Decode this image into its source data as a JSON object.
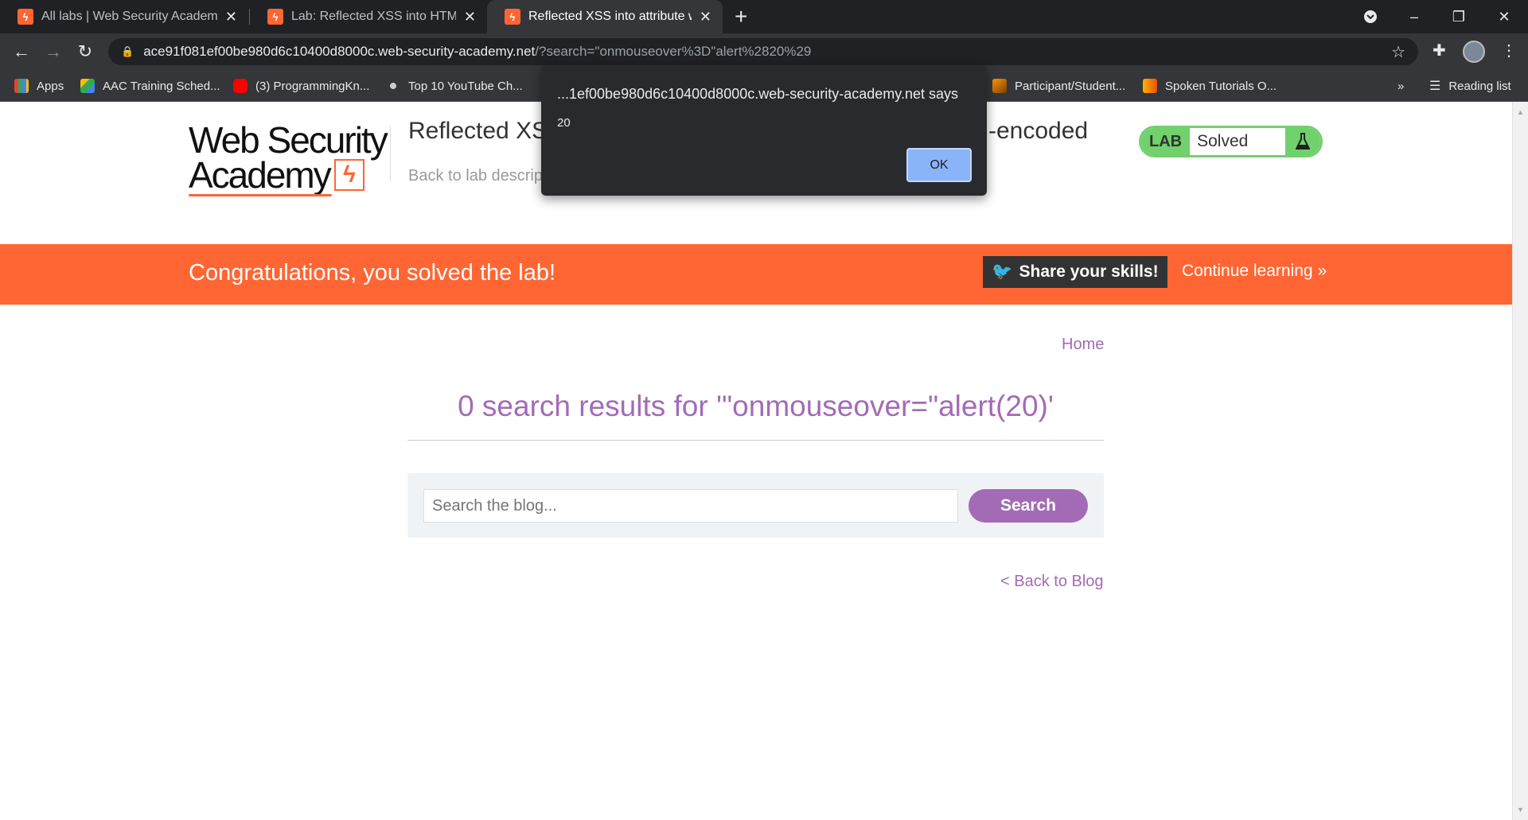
{
  "browser": {
    "tabs": [
      {
        "title": "All labs | Web Security Academy",
        "active": false
      },
      {
        "title": "Lab: Reflected XSS into HTML co",
        "active": false
      },
      {
        "title": "Reflected XSS into attribute with",
        "active": true
      }
    ],
    "url_host": "ace91f081ef00be980d6c10400d8000c.web-security-academy.net",
    "url_rest": "/?search=\"onmouseover%3D\"alert%2820%29",
    "bookmarks": [
      "Apps",
      "AAC Training Sched...",
      "(3) ProgrammingKn...",
      "Top 10 YouTube Ch...",
      "Participant/Student...",
      "Spoken Tutorials O..."
    ],
    "more_bookmarks": "»",
    "reading_list": "Reading list"
  },
  "header": {
    "logo_line1": "Web Security",
    "logo_line2": "Academy",
    "lab_title_start": "Reflected XS",
    "lab_title_end": "-encoded",
    "back_to_description": "Back to lab descrip",
    "lab_label": "LAB",
    "lab_status": "Solved"
  },
  "banner": {
    "message": "Congratulations, you solved the lab!",
    "share_label": "Share your skills!",
    "continue_label": "Continue learning"
  },
  "main": {
    "home_link": "Home",
    "results_heading": "0 search results for '\"onmouseover=\"alert(20)'",
    "search_placeholder": "Search the blog...",
    "search_button": "Search",
    "back_to_blog": "< Back to Blog"
  },
  "dialog": {
    "title": "...1ef00be980d6c10400d8000c.web-security-academy.net says",
    "message": "20",
    "ok_label": "OK"
  },
  "colors": {
    "accent_orange": "#ff6633",
    "purple": "#a36bb5",
    "solved_green": "#70d16d"
  }
}
